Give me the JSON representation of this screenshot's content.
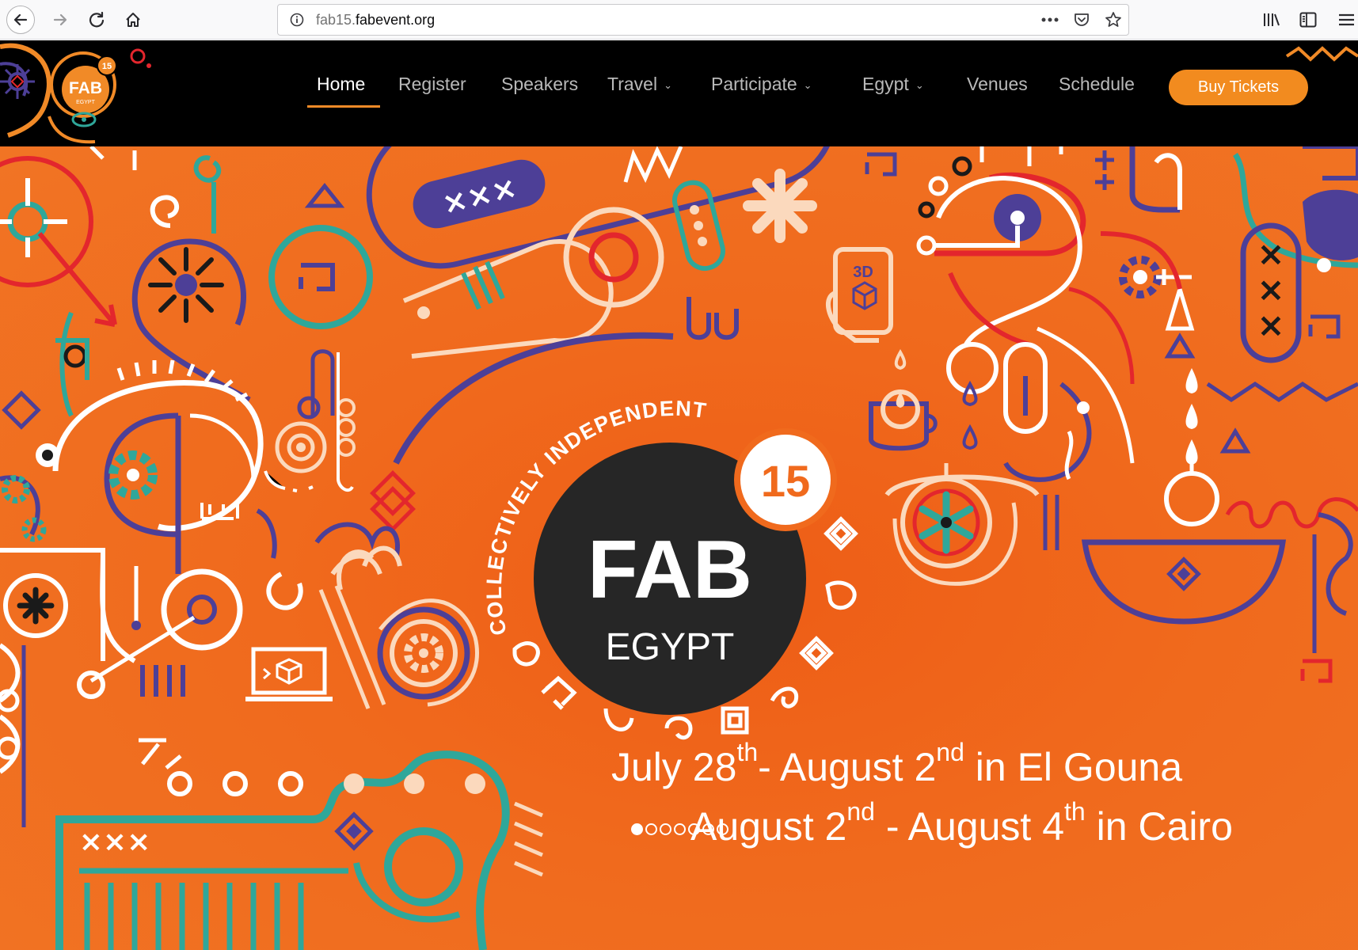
{
  "browser": {
    "url_prefix": "fab15.",
    "url_domain": "fabevent.org",
    "icons": [
      "back-arrow-icon",
      "forward-arrow-icon",
      "reload-icon",
      "home-icon",
      "site-info-icon",
      "page-actions-icon",
      "pocket-icon",
      "bookmark-star-icon",
      "library-icon",
      "sidebar-icon",
      "menu-icon"
    ]
  },
  "logo": {
    "arc_text": "COLLECTIVELY INDEPENDENT",
    "badge": "15",
    "title": "FAB",
    "subtitle": "EGYPT"
  },
  "nav": {
    "items": [
      {
        "label": "Home",
        "active": true
      },
      {
        "label": "Register"
      },
      {
        "label": "Speakers"
      },
      {
        "label": "Travel",
        "dropdown": true
      },
      {
        "label": "Participate",
        "dropdown": true
      },
      {
        "label": "Egypt",
        "dropdown": true
      },
      {
        "label": "Venues"
      },
      {
        "label": "Schedule"
      }
    ],
    "cta": "Buy Tickets"
  },
  "hero": {
    "emblem": {
      "arc_text": "COLLECTIVELY INDEPENDENT",
      "badge": "15",
      "title": "FAB",
      "subtitle": "EGYPT"
    },
    "dates": [
      {
        "parts": [
          "July 28",
          "th",
          "- August 2",
          "nd",
          " in El Gouna"
        ]
      },
      {
        "parts": [
          "August 2",
          "nd",
          " - August 4",
          "th",
          " in Cairo"
        ]
      }
    ],
    "slider": {
      "count": 7,
      "active": 1
    }
  },
  "colors": {
    "orange": "#f06a1d",
    "cta_orange": "#f28b1f",
    "purple": "#4d3f97",
    "teal": "#2fa79a",
    "red": "#e3262d",
    "dark": "#262626"
  }
}
